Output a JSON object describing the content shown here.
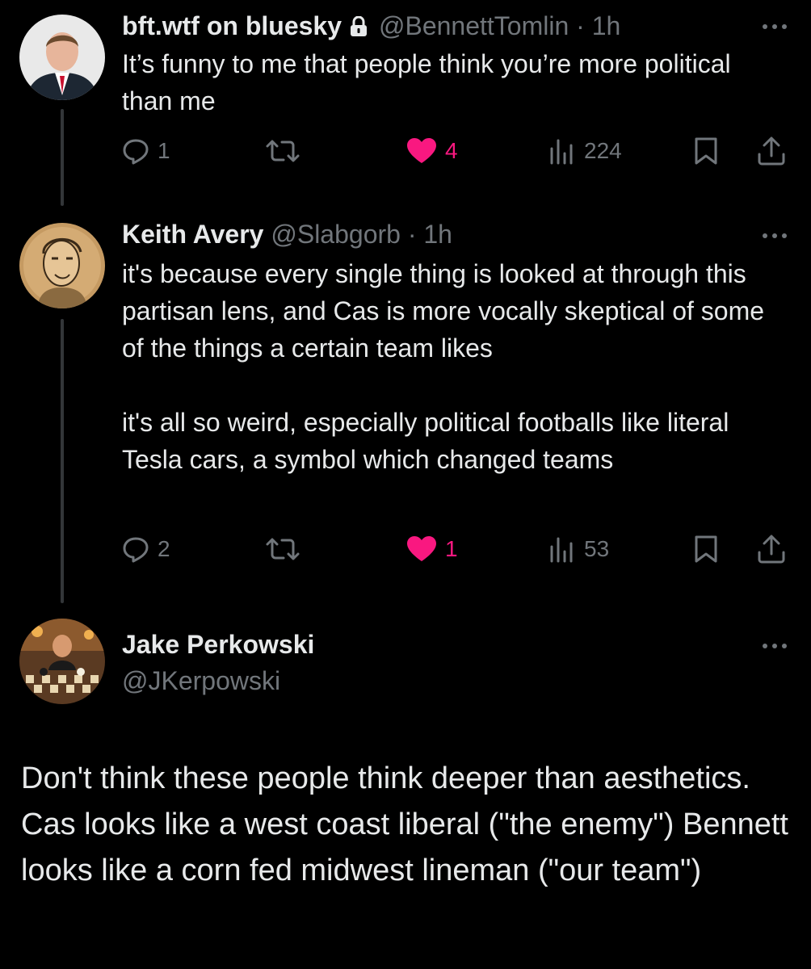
{
  "tweets": [
    {
      "name": "bft.wtf on bluesky",
      "handle": "@BennettTomlin",
      "time": "1h",
      "text": "It’s funny to me that people think you’re more political than me",
      "replies": "1",
      "likes": "4",
      "views": "224"
    },
    {
      "name": "Keith Avery",
      "handle": "@Slabgorb",
      "time": "1h",
      "text": "it's because every single thing is looked at through this partisan  lens, and Cas is more vocally skeptical of some of the things a certain team likes\n\nit's all so weird, especially political footballs like literal Tesla cars, a symbol which changed teams",
      "replies": "2",
      "likes": "1",
      "views": "53"
    }
  ],
  "main_tweet": {
    "name": "Jake Perkowski",
    "handle": "@JKerpowski",
    "text": "Don't think these people think deeper than aesthetics. Cas looks like a west coast liberal (\"the enemy\") Bennett looks like a corn fed midwest lineman (\"our team\")"
  },
  "colors": {
    "background": "#000000",
    "text": "#e7e9ea",
    "secondary": "#71767b",
    "like": "#f91880",
    "thread_line": "#333639"
  },
  "icons": [
    "lock-icon",
    "reply-icon",
    "retweet-icon",
    "heart-icon",
    "views-icon",
    "bookmark-icon",
    "share-icon",
    "more-icon"
  ]
}
